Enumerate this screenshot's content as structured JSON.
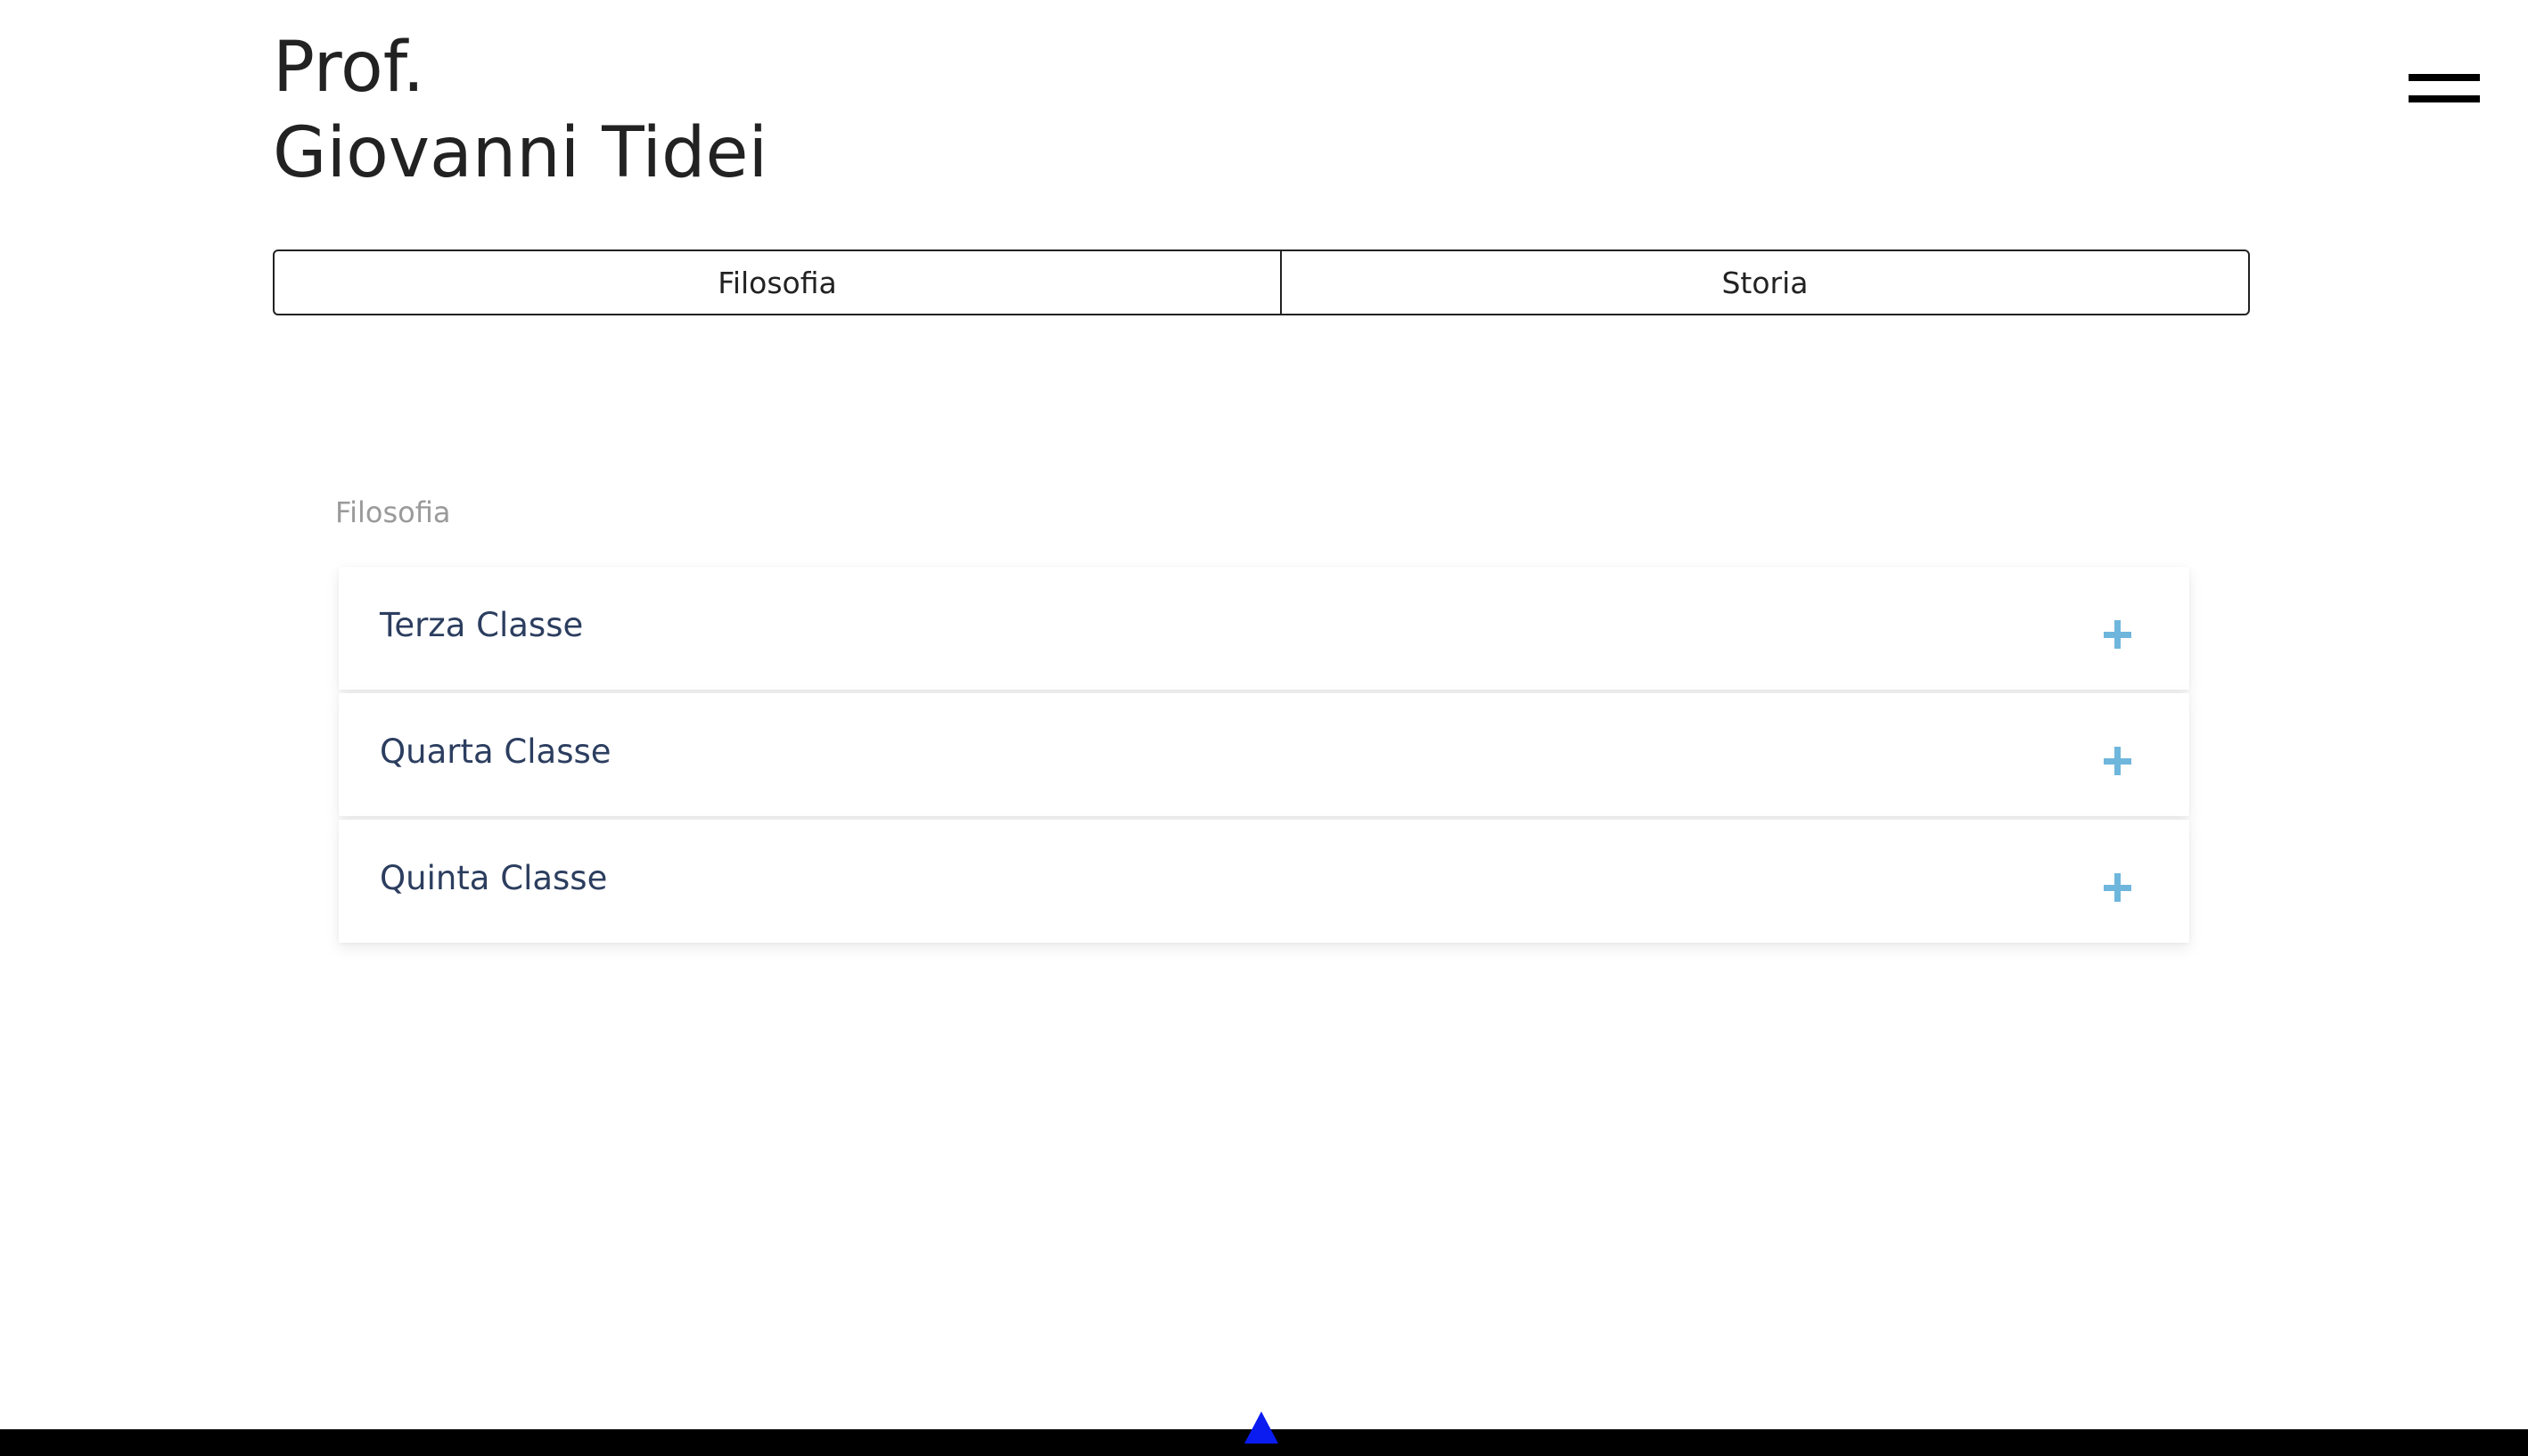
{
  "header": {
    "title_line1": "Prof.",
    "title_line2": "Giovanni Tidei",
    "menu_icon": "hamburger-menu-icon"
  },
  "tabs": [
    {
      "label": "Filosofia"
    },
    {
      "label": "Storia"
    }
  ],
  "section": {
    "label": "Filosofia"
  },
  "accordion": {
    "items": [
      {
        "label": "Terza Classe",
        "icon": "plus-icon"
      },
      {
        "label": "Quarta Classe",
        "icon": "plus-icon"
      },
      {
        "label": "Quinta Classe",
        "icon": "plus-icon"
      }
    ]
  },
  "footer": {
    "scroll_top_icon": "triangle-up-icon"
  },
  "colors": {
    "accent_plus": "#6fb6dd",
    "accordion_text": "#2c3e5f",
    "section_label": "#9a9a9a",
    "scroll_top": "#0a1cf0",
    "bottom_bar": "#000000"
  }
}
